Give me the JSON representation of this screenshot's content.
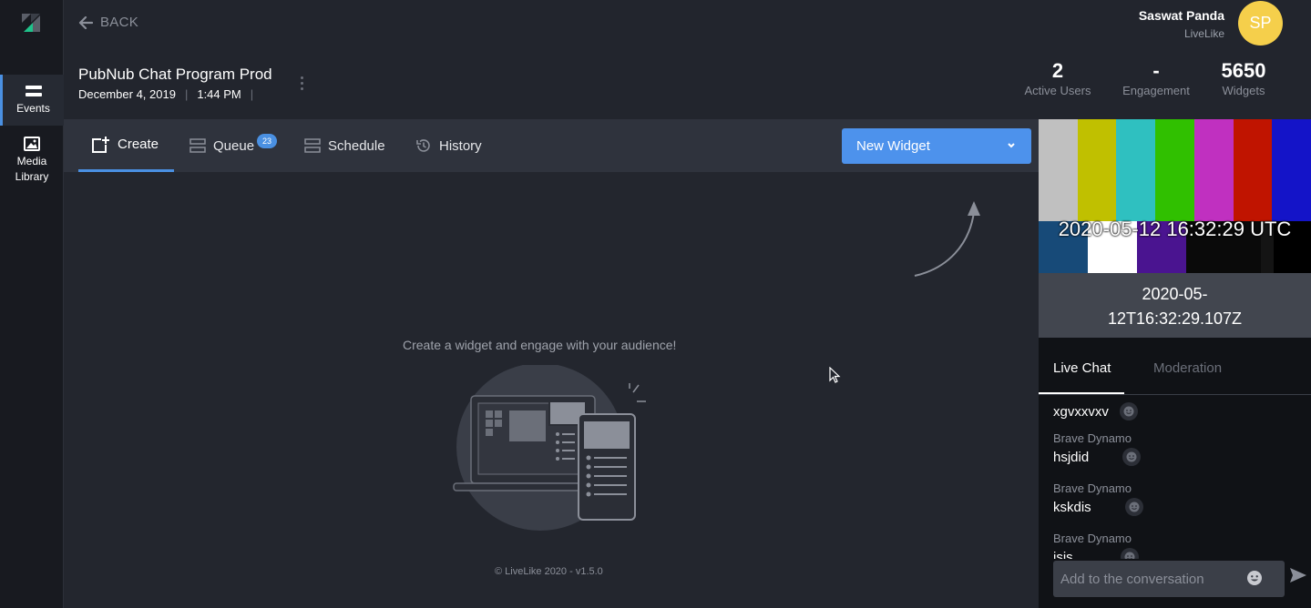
{
  "nav": {
    "items": [
      {
        "label": "Events",
        "icon": "events-icon"
      },
      {
        "label_line1": "Media",
        "label_line2": "Library",
        "icon": "image-icon"
      }
    ]
  },
  "header": {
    "back_label": "BACK",
    "event_title": "PubNub Chat Program Prod",
    "event_date": "December 4, 2019",
    "event_time": "1:44 PM",
    "user_name": "Saswat Panda",
    "user_org": "LiveLike",
    "avatar_initials": "SP",
    "stats": [
      {
        "value": "2",
        "label": "Active Users"
      },
      {
        "value": "-",
        "label": "Engagement"
      },
      {
        "value": "5650",
        "label": "Widgets"
      }
    ]
  },
  "tabs": {
    "create": "Create",
    "queue": "Queue",
    "queue_badge": "23",
    "schedule": "Schedule",
    "history": "History",
    "new_widget": "New Widget"
  },
  "main": {
    "hint": "Create a widget and engage with your audience!",
    "footer": "© LiveLike 2020 - v1.5.0"
  },
  "video": {
    "overlay_timestamp": "2020-05-12 16:32:29 UTC",
    "timecode_line1": "2020-05-",
    "timecode_line2": "12T16:32:29.107Z"
  },
  "chat": {
    "tab_live": "Live Chat",
    "tab_moderation": "Moderation",
    "messages": [
      {
        "author": "",
        "text": "xgvxxvxv"
      },
      {
        "author": "Brave Dynamo",
        "text": "hsjdid"
      },
      {
        "author": "Brave Dynamo",
        "text": "kskdis"
      },
      {
        "author": "Brave Dynamo",
        "text": "isis"
      }
    ],
    "placeholder": "Add to the conversation"
  },
  "colors": {
    "accent": "#4a90e2",
    "button": "#4d92ec",
    "avatar": "#f5cf4b",
    "sidebar": "#181a20",
    "background": "#22252d"
  }
}
